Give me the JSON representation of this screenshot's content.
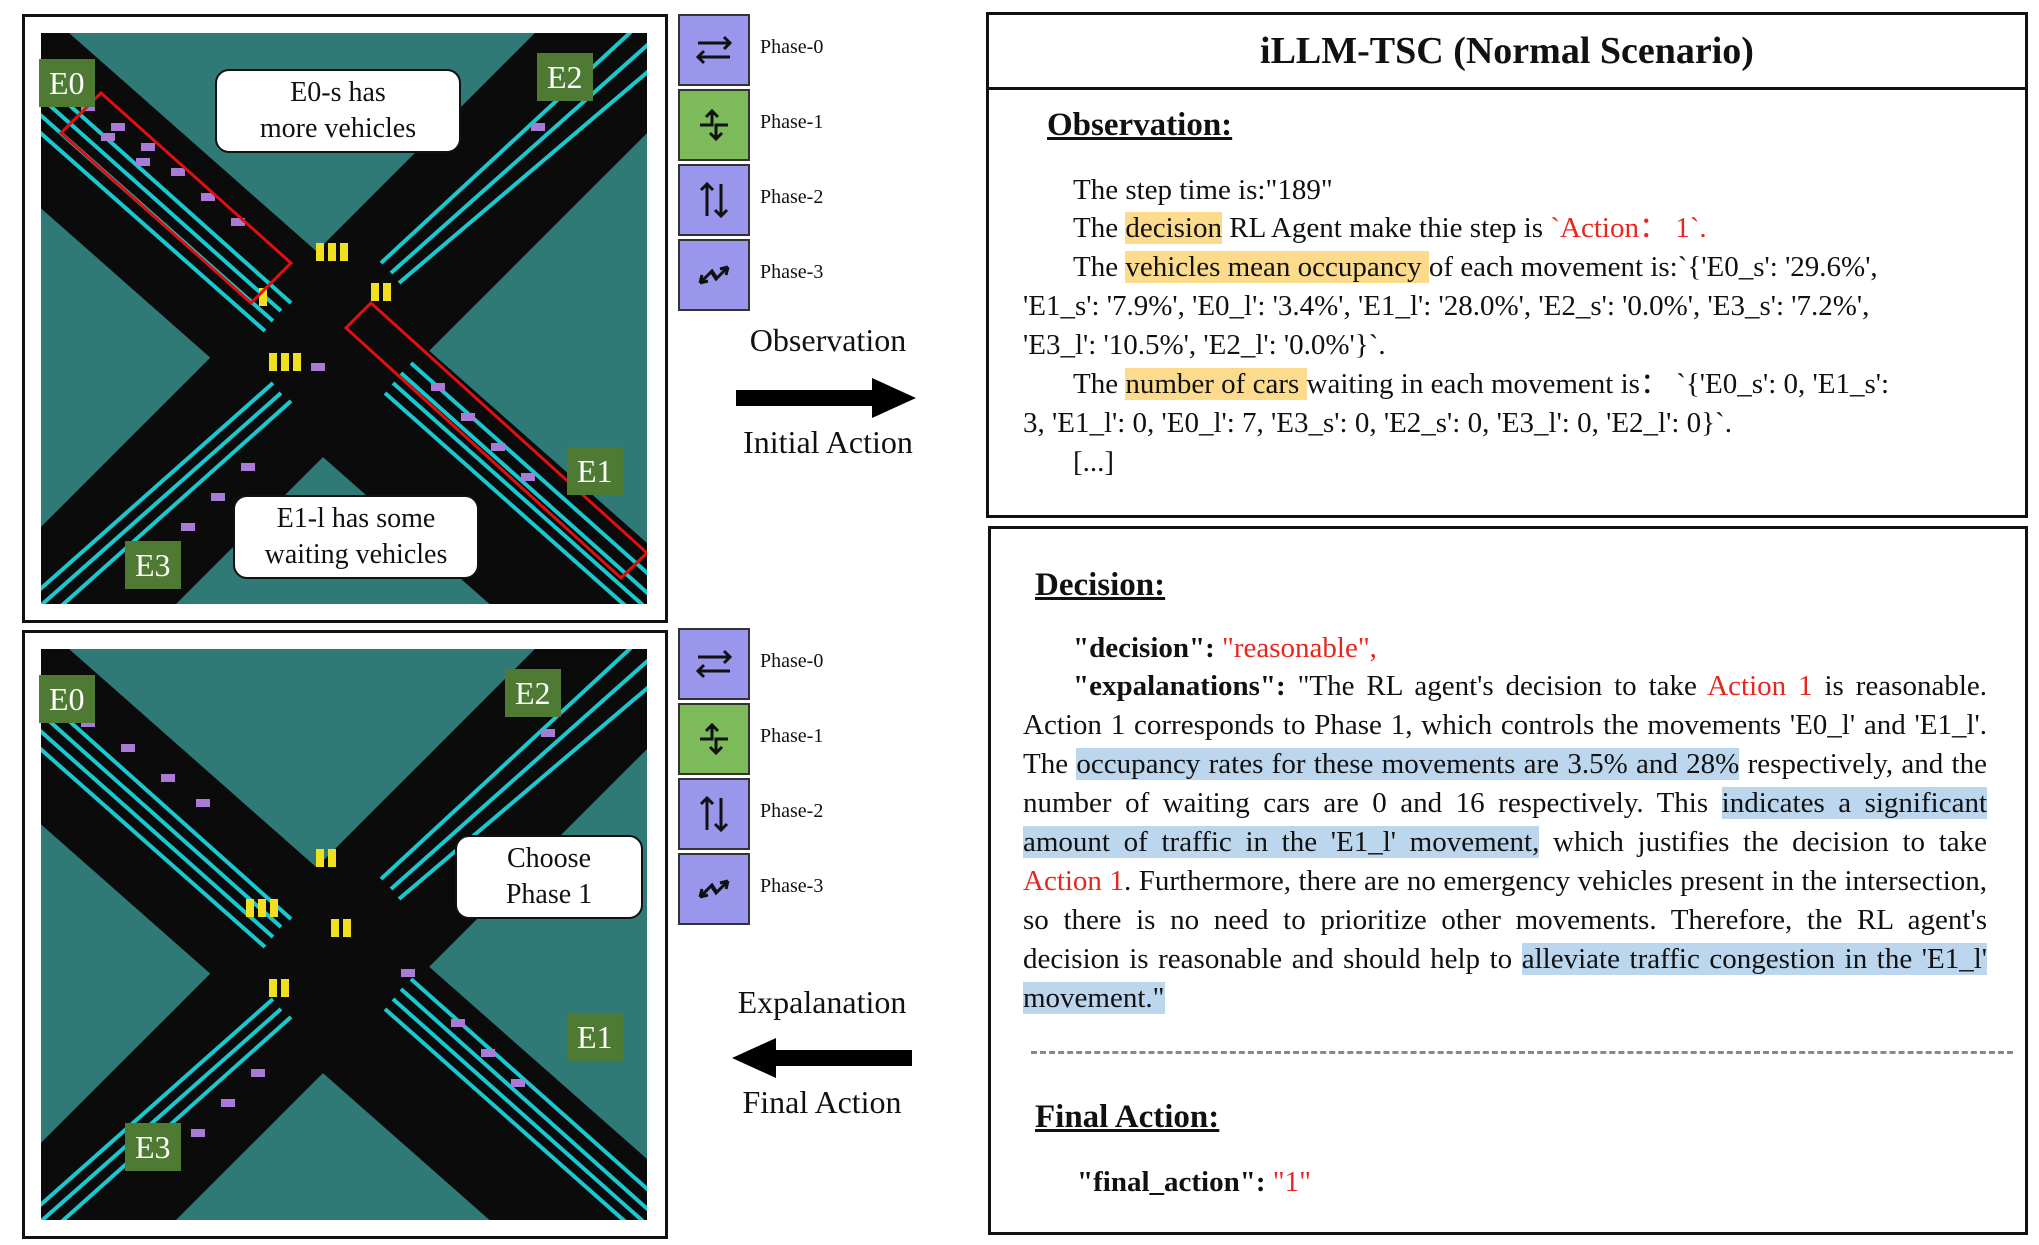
{
  "panels": {
    "top": {
      "edges": {
        "e0": "E0",
        "e1": "E1",
        "e2": "E2",
        "e3": "E3"
      },
      "callout_a": [
        "E0-s has",
        "more vehicles"
      ],
      "callout_b": [
        "E1-l has some",
        "waiting vehicles"
      ]
    },
    "bottom": {
      "edges": {
        "e0": "E0",
        "e1": "E1",
        "e2": "E2",
        "e3": "E3"
      },
      "callout_a": [
        "Choose",
        "Phase 1"
      ]
    }
  },
  "phases": [
    "Phase-0",
    "Phase-1",
    "Phase-2",
    "Phase-3"
  ],
  "active_phase_top": "Phase-1",
  "active_phase_bottom": "Phase-1",
  "middle": {
    "top_above": "Observation",
    "top_below": "Initial Action",
    "bottom_above": "Expalanation",
    "bottom_below": "Final Action"
  },
  "right": {
    "title": "iLLM-TSC (Normal Scenario)",
    "observation": {
      "heading": "Observation:",
      "step": "The step time is:\"189\"",
      "line2_pre": "The ",
      "line2_hl": "decision",
      "line2_mid": " RL Agent make thie step is ",
      "line2_red": "`Action： 1`.",
      "line3_pre": "The ",
      "line3_hl": "vehicles mean occupancy ",
      "line3_post": "of each movement is:`{'E0_s': '29.6%',",
      "line4": "'E1_s': '7.9%', 'E0_l': '3.4%', 'E1_l': '28.0%', 'E2_s': '0.0%', 'E3_s': '7.2%',",
      "line5": "'E3_l': '10.5%', 'E2_l': '0.0%'}`.",
      "line6_pre": "The ",
      "line6_hl": "number of cars ",
      "line6_post": "waiting in each movement is： `{'E0_s': 0, 'E1_s':",
      "line7": "3, 'E1_l': 0, 'E0_l': 7, 'E3_s': 0, 'E2_s': 0, 'E3_l': 0, 'E2_l': 0}`.",
      "ellipsis": "[...]"
    },
    "decision": {
      "heading": "Decision:",
      "key1": "\"decision\": ",
      "val1": "\"reasonable\",",
      "key2": "\"expalanations\": ",
      "t1": "\"The RL agent's decision to take ",
      "r1": "Action 1",
      "t2": " is reasonable. Action 1 corresponds to Phase 1, which controls the movements 'E0_l' and 'E1_l'. The ",
      "b1": "occupancy rates for these movements are 3.5% and 28%",
      "t3": " respectively, and the number of waiting cars are 0 and 16 respectively. This ",
      "b2": "indicates a significant amount of traffic in the 'E1_l' movement,",
      "t4": " which justifies the decision to take ",
      "r2": "Action 1",
      "t5": ". Furthermore, there are no emergency vehicles present in the intersection, so there is no need to prioritize other movements. Therefore, the RL agent's decision is reasonable and should help to ",
      "b3": "alleviate traffic congestion in the 'E1_l' movement.\""
    },
    "final": {
      "heading": "Final Action:",
      "key": "\"final_action\": ",
      "val": "\"1\""
    }
  },
  "colors": {
    "grass": "#2f7a76",
    "road": "#0b0b0b",
    "lane": "#19c9cf",
    "car": "#a77bd6",
    "signal": "#f0e020",
    "highlight_box": "#e01010",
    "phase_idle": "#9a96ec",
    "phase_active": "#7dbb5a",
    "edge_tag": "#4f7a34",
    "text_red": "#e8261f",
    "hl_yellow": "#fcdc8c",
    "hl_blue": "#bcd6ee"
  }
}
